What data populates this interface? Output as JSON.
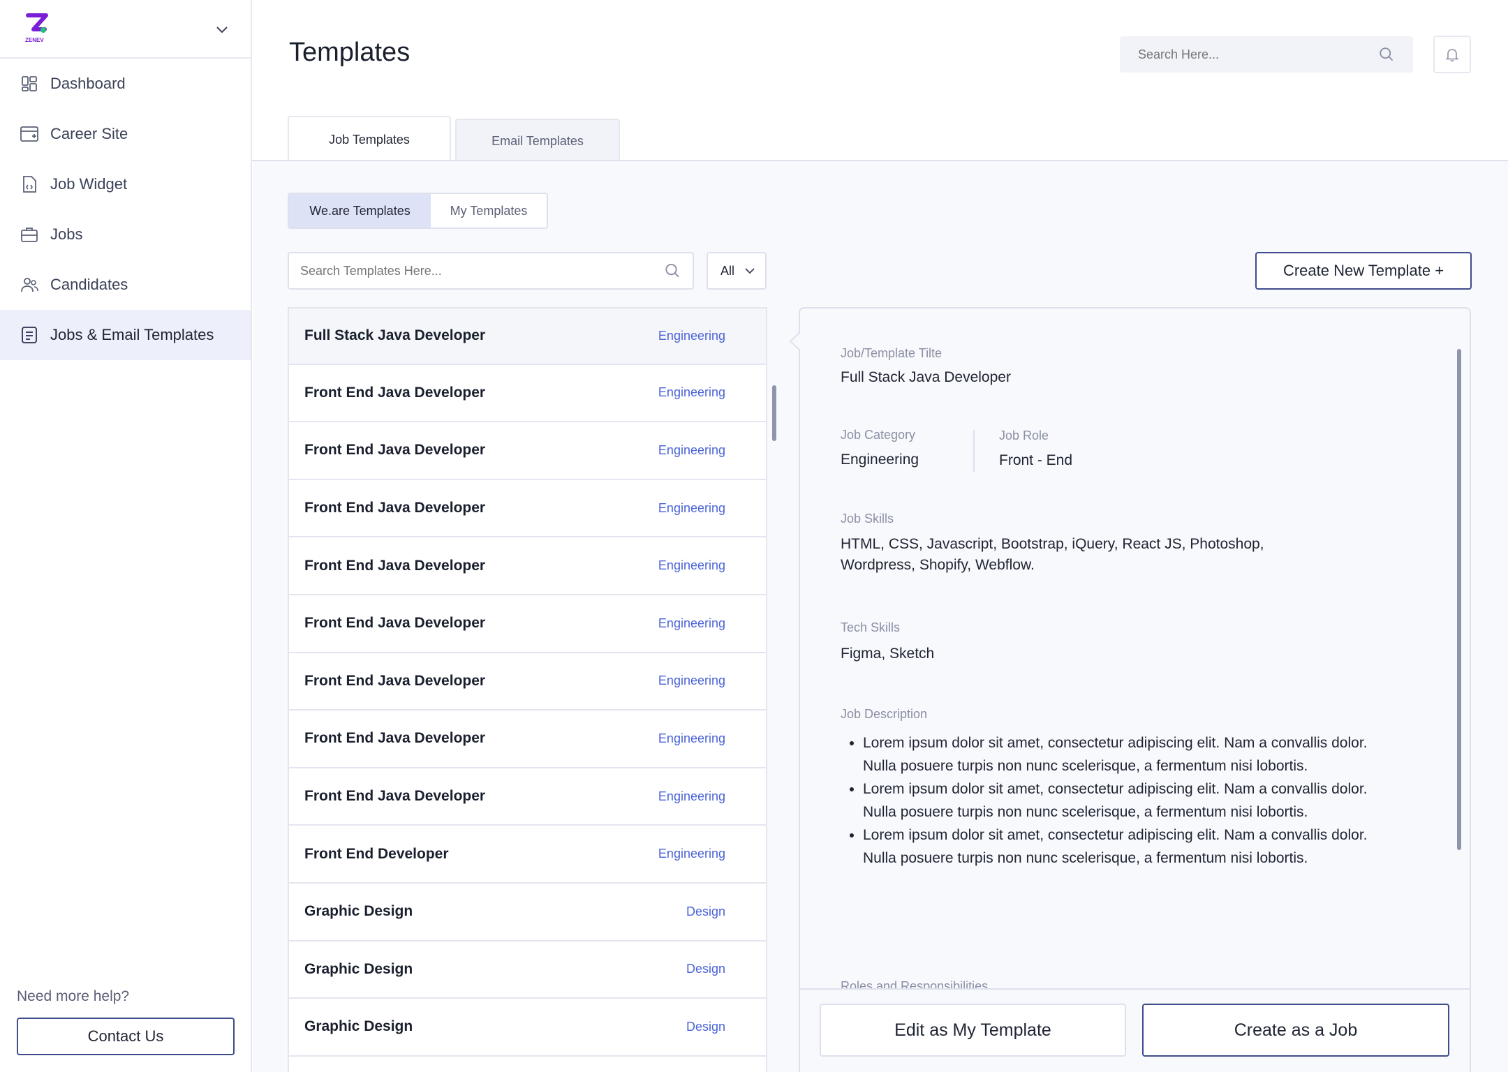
{
  "brand": {
    "logo_text": "ZENEV",
    "logo_colors": [
      "#7b1fd6",
      "#22c07a"
    ]
  },
  "sidebar": {
    "items": [
      {
        "label": "Dashboard",
        "icon": "dashboard-icon"
      },
      {
        "label": "Career Site",
        "icon": "browser-window-icon"
      },
      {
        "label": "Job Widget",
        "icon": "code-file-icon"
      },
      {
        "label": "Jobs",
        "icon": "briefcase-icon"
      },
      {
        "label": "Candidates",
        "icon": "people-icon"
      },
      {
        "label": "Jobs & Email Templates",
        "icon": "template-icon",
        "active": true
      }
    ],
    "help_text": "Need more help?",
    "contact_label": "Contact Us"
  },
  "header": {
    "title": "Templates",
    "search_placeholder": "Search Here..."
  },
  "tabs": [
    {
      "label": "Job Templates",
      "active": true
    },
    {
      "label": "Email Templates",
      "active": false
    }
  ],
  "segments": [
    {
      "label": "We.are Templates",
      "active": true
    },
    {
      "label": "My Templates",
      "active": false
    }
  ],
  "template_search": {
    "placeholder": "Search Templates Here...",
    "filter_value": "All"
  },
  "create_button": "Create New Template +",
  "templates": [
    {
      "name": "Full Stack Java Developer",
      "category": "Engineering"
    },
    {
      "name": "Front End Java Developer",
      "category": "Engineering"
    },
    {
      "name": "Front End Java Developer",
      "category": "Engineering"
    },
    {
      "name": "Front End Java Developer",
      "category": "Engineering"
    },
    {
      "name": "Front End Java Developer",
      "category": "Engineering"
    },
    {
      "name": "Front End Java Developer",
      "category": "Engineering"
    },
    {
      "name": "Front End Java Developer",
      "category": "Engineering"
    },
    {
      "name": "Front End Java Developer",
      "category": "Engineering"
    },
    {
      "name": "Front End Java Developer",
      "category": "Engineering"
    },
    {
      "name": "Front End Developer",
      "category": "Engineering"
    },
    {
      "name": "Graphic Design",
      "category": "Design"
    },
    {
      "name": "Graphic Design",
      "category": "Design"
    },
    {
      "name": "Graphic Design",
      "category": "Design"
    },
    {
      "name": "",
      "category": ""
    }
  ],
  "detail": {
    "title_label": "Job/Template Tilte",
    "title_value": "Full Stack Java Developer",
    "category_label": "Job Category",
    "category_value": "Engineering",
    "role_label": "Job Role",
    "role_value": "Front - End",
    "skills_label": "Job Skills",
    "skills_value": "HTML, CSS, Javascript, Bootstrap, iQuery, React JS, Photoshop, Wordpress, Shopify, Webflow.",
    "tech_label": "Tech Skills",
    "tech_value": "Figma, Sketch",
    "desc_label": "Job Description",
    "desc_items": [
      "Lorem ipsum dolor sit amet, consectetur adipiscing elit. Nam a convallis dolor. Nulla posuere turpis non nunc scelerisque, a fermentum nisi lobortis.",
      "Lorem ipsum dolor sit amet, consectetur adipiscing elit. Nam a convallis dolor. Nulla posuere turpis non nunc scelerisque, a fermentum nisi lobortis.",
      "Lorem ipsum dolor sit amet, consectetur adipiscing elit. Nam a convallis dolor. Nulla posuere turpis non nunc scelerisque, a fermentum nisi lobortis."
    ],
    "roles_label": "Roles and Responsibilities"
  },
  "footer": {
    "edit_label": "Edit as My Template",
    "create_job_label": "Create as a Job"
  }
}
